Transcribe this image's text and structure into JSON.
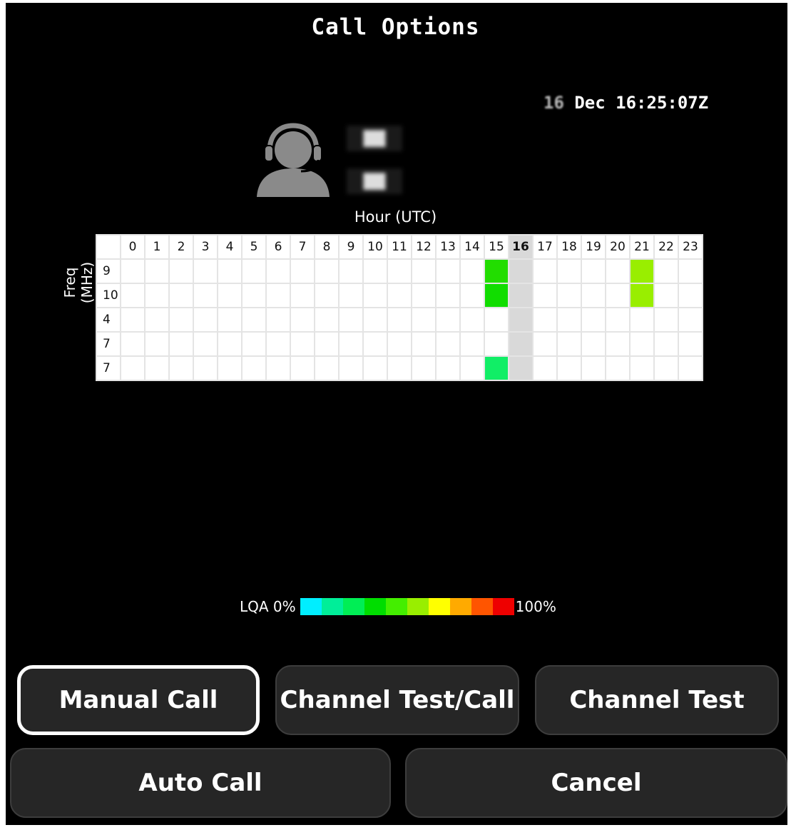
{
  "title": "Call Options",
  "clock": {
    "day": "16",
    "rest": "Dec 16:25:07Z"
  },
  "contact": {
    "icon": "operator-headset-icon",
    "line1": "██",
    "line2": "██"
  },
  "grid": {
    "hour_label": "Hour (UTC)",
    "freq_label": "Freq (MHz)",
    "hours": [
      "0",
      "1",
      "2",
      "3",
      "4",
      "5",
      "6",
      "7",
      "8",
      "9",
      "10",
      "11",
      "12",
      "13",
      "14",
      "15",
      "16",
      "17",
      "18",
      "19",
      "20",
      "21",
      "22",
      "23"
    ],
    "current_hour": "16",
    "rows": [
      {
        "freq": "9",
        "cells": {
          "15": "#22dd00",
          "21": "#99ee00"
        }
      },
      {
        "freq": "10",
        "cells": {
          "15": "#11dd00",
          "21": "#99ee00"
        }
      },
      {
        "freq": "4",
        "cells": {}
      },
      {
        "freq": "7",
        "cells": {}
      },
      {
        "freq": "7",
        "cells": {
          "15": "#11ee66"
        }
      }
    ]
  },
  "legend": {
    "label_low": "LQA 0%",
    "label_high": "100%",
    "colors": [
      "#00eeff",
      "#00ee99",
      "#00ee55",
      "#00dd00",
      "#44ee00",
      "#99ee00",
      "#ffff00",
      "#ffaa00",
      "#ff5500",
      "#ee0000"
    ]
  },
  "buttons": {
    "manual_call": "Manual Call",
    "channel_test_call": "Channel Test/Call",
    "channel_test": "Channel Test",
    "auto_call": "Auto Call",
    "cancel": "Cancel"
  }
}
